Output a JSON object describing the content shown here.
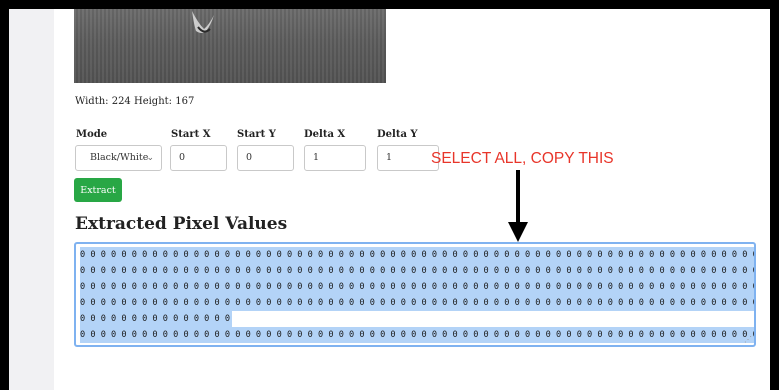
{
  "image_info": {
    "width_text": "Width: 224 Height: 167"
  },
  "controls": {
    "mode_label": "Mode",
    "mode_value": "Black/White",
    "start_x_label": "Start X",
    "start_x_value": "0",
    "start_y_label": "Start Y",
    "start_y_value": "0",
    "delta_x_label": "Delta X",
    "delta_x_value": "1",
    "delta_y_label": "Delta Y",
    "delta_y_value": "1",
    "extract_label": "Extract"
  },
  "output": {
    "title": "Extracted Pixel Values",
    "lines": [
      "0 0 0 0 0 0 0 0 0 0 0 0 0 0 0 0 0 0 0 0 0 0 0 0 0 0 0 0 0 0 0 0 0 0 0 0 0 0 0 0 0 0 0 0 0 0 0 0 0 0 0 0 0 0 0 0 0 0 0 0 0 0 0 0 0 0 0 0 0 0 0 0 0 0 0",
      "0 0 0 0 0 0 0 0 0 0 0 0 0 0 0 0 0 0 0 0 0 0 0 0 0 0 0 0 0 0 0 0 0 0 0 0 0 0 0 0 0 0 0 0 0 0 0 0 0 0 0 0 0 0 0 0 0 0 0 0 0 0 0 0 0 0 0 0 0 0 0 0 0 0 0",
      "0 0 0 0 0 0 0 0 0 0 0 0 0 0 0 0 0 0 0 0 0 0 0 0 0 0 0 0 0 0 0 0 0 0 0 0 0 0 0 0 0 0 0 0 0 0 0 0 0 0 0 0 0 0 0 0 0 0 0 0 0 0 0 0 0 0 0 0 0 0 0 0 0 0 0",
      "0 0 0 0 0 0 0 0 0 0 0 0 0 0 0 0 0 0 0 0 0 0 0 0 0 0 0 0 0 0 0 0 0 0 0 0 0 0 0 0 0 0 0 0 0 0 0 0 0 0 0 0 0 0 0 0 0 0 0 0 0 0 0 0 0 0 0 0 0 0 0 0 0 0 0",
      "0 0 0 0 0 0 0 0 0 0 0 0 0 0 0",
      "0 0 0 0 0 0 0 0 0 0 0 0 0 0 0 0 0 0 0 0 0 0 0 0 0 0 0 0 0 0 0 0 0 0 0 0 0 0 0 0 0 0 0 0 0 0 0 0 0 0 0 0 0 0 0 0 0 0 0 0 0 0 0 0 0 0 0 0 0 0 0 0 0 0 0"
    ]
  },
  "annotation": {
    "text": "SELECT ALL, COPY THIS",
    "color": "#e8352a"
  },
  "icons": {
    "select_chevron": "chevron-down-icon",
    "arrow": "arrow-down-icon"
  },
  "colors": {
    "extract_button": "#28a745",
    "selection": "#b3d3f7",
    "textarea_focus": "#7fb2f0"
  }
}
